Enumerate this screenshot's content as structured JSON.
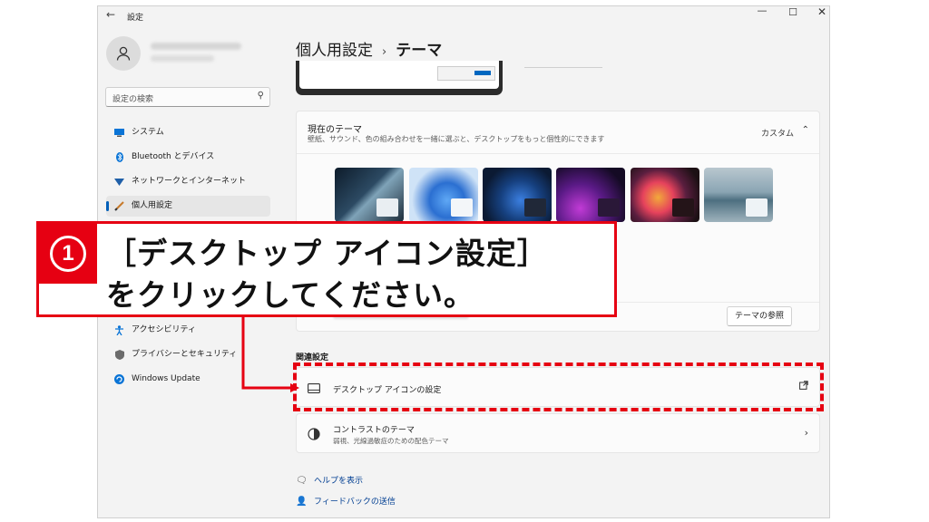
{
  "window": {
    "back_glyph": "←",
    "title": "設定",
    "minimize_glyph": "—",
    "maximize_glyph": "☐",
    "close_glyph": "✕"
  },
  "sidebar": {
    "search_placeholder": "設定の検索",
    "items": [
      {
        "label": "システム",
        "icon": "monitor-icon"
      },
      {
        "label": "Bluetooth とデバイス",
        "icon": "bluetooth-icon"
      },
      {
        "label": "ネットワークとインターネット",
        "icon": "wifi-icon"
      },
      {
        "label": "個人用設定",
        "icon": "brush-icon",
        "active": true
      },
      {
        "label": "アクセシビリティ",
        "icon": "accessibility-icon"
      },
      {
        "label": "プライバシーとセキュリティ",
        "icon": "shield-icon"
      },
      {
        "label": "Windows Update",
        "icon": "update-icon"
      }
    ]
  },
  "breadcrumb": {
    "parent": "個人用設定",
    "separator": "›",
    "current": "テーマ"
  },
  "themes_card": {
    "title": "現在のテーマ",
    "subtitle": "壁紙、サウンド、色の組み合わせを一緒に選ぶと、デスクトップをもっと個性的にできます",
    "current_value": "カスタム",
    "browse_button": "テーマの参照"
  },
  "related": {
    "heading": "関連設定",
    "desktop_icons": {
      "label": "デスクトップ アイコンの設定",
      "end_icon": "external-link-icon"
    },
    "contrast": {
      "label": "コントラストのテーマ",
      "sub": "弱視、光線過敏症のための配色テーマ"
    }
  },
  "footer_links": {
    "help": "ヘルプを表示",
    "feedback": "フィードバックの送信"
  },
  "callout": {
    "number": "1",
    "line1": "［デスクトップ アイコン設定］",
    "line2": "をクリックしてください。"
  },
  "colors": {
    "accent": "#005fb8",
    "annotation_red": "#e60012"
  }
}
